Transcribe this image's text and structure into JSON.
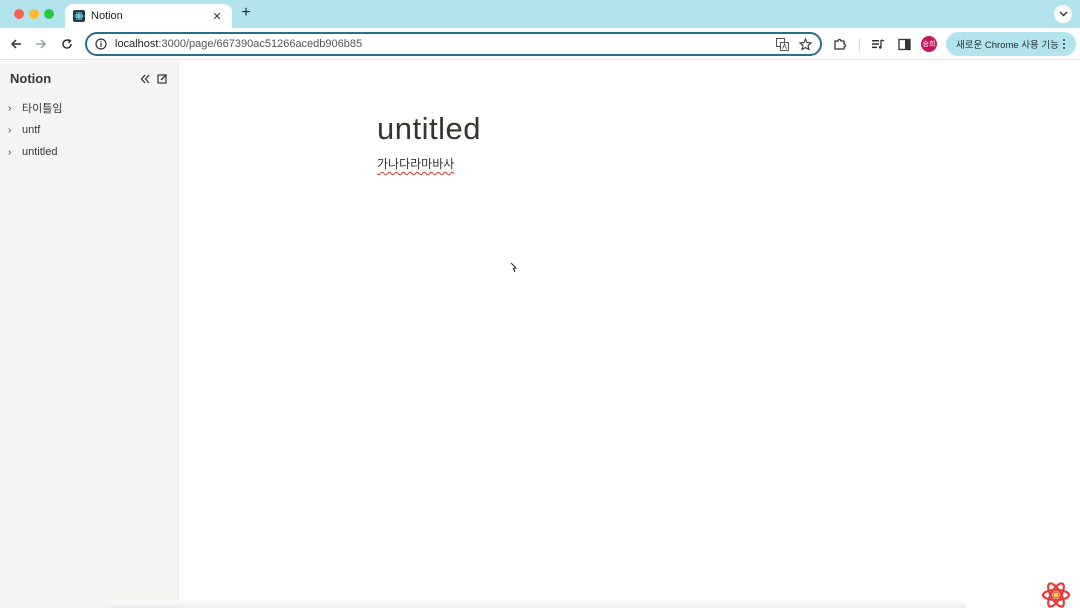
{
  "browser": {
    "tab": {
      "title": "Notion"
    },
    "address": {
      "host": "localhost",
      "path": ":3000/page/667390ac51266acedb906b85"
    },
    "profile_initials": "승희",
    "chrome_pill_label": "새로운 Chrome 사용 기능"
  },
  "sidebar": {
    "title": "Notion",
    "items": [
      {
        "label": "타이틀임"
      },
      {
        "label": "untf"
      },
      {
        "label": "untitled"
      }
    ]
  },
  "page": {
    "title": "untitled",
    "body": "가나다라마바사"
  },
  "colors": {
    "tabstrip": "#b3e4ee",
    "omnibox_border": "#2c6d8e",
    "sidebar_bg": "#f5f5f4",
    "avatar": "#c2185b"
  }
}
